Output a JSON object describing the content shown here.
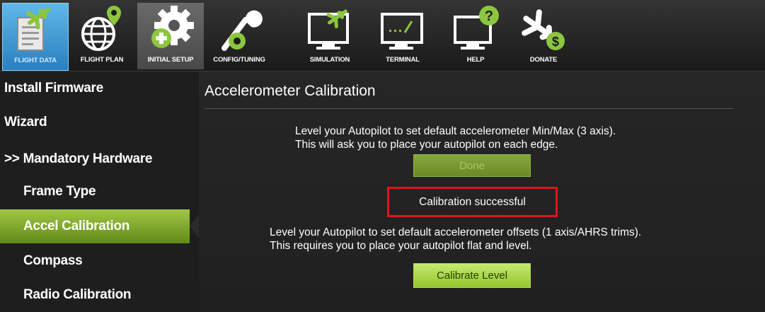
{
  "toolbar": {
    "items": [
      {
        "label": "FLIGHT DATA",
        "icon": "flight-data-icon"
      },
      {
        "label": "FLIGHT PLAN",
        "icon": "flight-plan-icon"
      },
      {
        "label": "INITIAL SETUP",
        "icon": "initial-setup-icon"
      },
      {
        "label": "CONFIG/TUNING",
        "icon": "config-tuning-icon"
      },
      {
        "label": "SIMULATION",
        "icon": "simulation-icon"
      },
      {
        "label": "TERMINAL",
        "icon": "terminal-icon"
      },
      {
        "label": "HELP",
        "icon": "help-icon"
      },
      {
        "label": "DONATE",
        "icon": "donate-icon"
      }
    ],
    "accent_blue": "#2a7fbf",
    "accent_green": "#7fb93a"
  },
  "sidebar": {
    "items": [
      {
        "label": "Install Firmware"
      },
      {
        "label": "Wizard"
      },
      {
        "label": ">> Mandatory Hardware"
      },
      {
        "label": "Frame Type"
      },
      {
        "label": "Accel Calibration",
        "active": true
      },
      {
        "label": "Compass"
      },
      {
        "label": "Radio Calibration"
      }
    ],
    "active_color": "#7fae2a"
  },
  "main": {
    "title": "Accelerometer Calibration",
    "accel_line1": "Level your Autopilot to set default accelerometer Min/Max (3 axis).",
    "accel_line2": "This will ask you to place your autopilot on each edge.",
    "done_button": "Done",
    "status": "Calibration successful",
    "status_highlight": "#e0141c",
    "level_line1": "Level your Autopilot to set default accelerometer offsets (1 axis/AHRS trims).",
    "level_line2": "This requires you to place your autopilot flat and level.",
    "calibrate_button": "Calibrate Level"
  }
}
